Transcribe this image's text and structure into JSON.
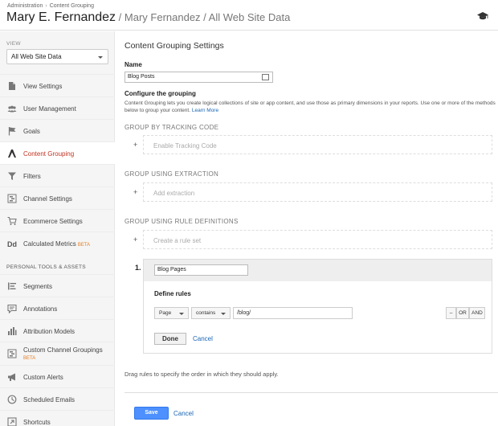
{
  "header": {
    "breadcrumb": [
      "Administration",
      "Content Grouping"
    ],
    "breadcrumb_sep": "›",
    "title_main": "Mary E. Fernandez",
    "title_rest": " / Mary Fernandez / All Web Site Data"
  },
  "sidebar": {
    "view_label": "VIEW",
    "view_value": "All Web Site Data",
    "items": [
      {
        "label": "View Settings",
        "icon": "document-icon"
      },
      {
        "label": "User Management",
        "icon": "users-icon"
      },
      {
        "label": "Goals",
        "icon": "flag-icon"
      },
      {
        "label": "Content Grouping",
        "icon": "content-grouping-icon",
        "active": true
      },
      {
        "label": "Filters",
        "icon": "filter-icon"
      },
      {
        "label": "Channel Settings",
        "icon": "channel-icon"
      },
      {
        "label": "Ecommerce Settings",
        "icon": "cart-icon"
      },
      {
        "label": "Calculated Metrics",
        "icon": "dd-icon",
        "badge": "BETA"
      }
    ],
    "tools_label": "PERSONAL TOOLS & ASSETS",
    "tools": [
      {
        "label": "Segments",
        "icon": "segments-icon"
      },
      {
        "label": "Annotations",
        "icon": "annotation-icon"
      },
      {
        "label": "Attribution Models",
        "icon": "bar-chart-icon"
      },
      {
        "label": "Custom Channel Groupings",
        "icon": "custom-channel-icon",
        "badge": "BETA"
      },
      {
        "label": "Custom Alerts",
        "icon": "megaphone-icon"
      },
      {
        "label": "Scheduled Emails",
        "icon": "clock-icon"
      },
      {
        "label": "Shortcuts",
        "icon": "shortcut-icon"
      }
    ]
  },
  "main": {
    "title": "Content Grouping Settings",
    "name_label": "Name",
    "name_value": "Blog Posts",
    "configure_label": "Configure the grouping",
    "configure_desc": "Content Grouping lets you create logical collections of site or app content, and use those as primary dimensions in your reports. Use one or more of the methods below to group your content.",
    "learn_more": "Learn More",
    "tracking_head": "GROUP BY TRACKING CODE",
    "tracking_action": "Enable Tracking Code",
    "extraction_head": "GROUP USING EXTRACTION",
    "extraction_action": "Add extraction",
    "rules_head": "GROUP USING RULE DEFINITIONS",
    "rules_action": "Create a rule set",
    "plus": "+",
    "rule": {
      "number": "1.",
      "name": "Blog Pages",
      "define_label": "Define rules",
      "dimension": "Page",
      "operator": "contains",
      "value": "/blog/",
      "minus": "–",
      "or": "OR",
      "and": "AND",
      "done": "Done",
      "cancel": "Cancel"
    },
    "drag_hint": "Drag rules to specify the order in which they should apply.",
    "save": "Save",
    "cancel": "Cancel"
  },
  "colors": {
    "accent": "#4d90fe",
    "active_nav": "#c23321",
    "link": "#1a66b5",
    "beta": "#e57c1f"
  }
}
